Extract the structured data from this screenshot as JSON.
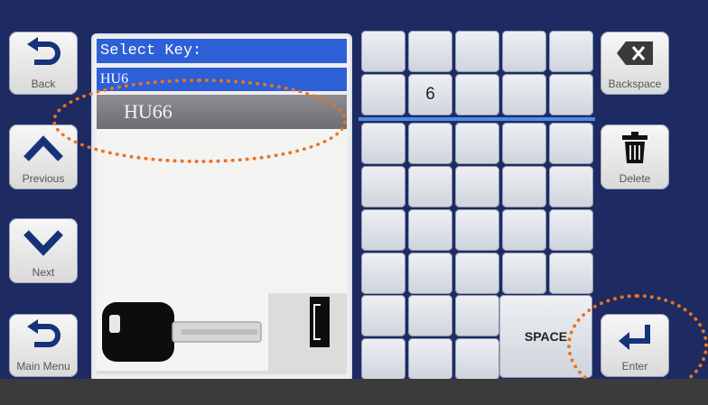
{
  "left_buttons": [
    {
      "label": "Back",
      "icon": "back-arrow-icon"
    },
    {
      "label": "Previous",
      "icon": "chevron-up-icon"
    },
    {
      "label": "Next",
      "icon": "chevron-down-icon"
    },
    {
      "label": "Main Menu",
      "icon": "back-arrow-icon"
    }
  ],
  "right_buttons": [
    {
      "label": "Backspace",
      "icon": "backspace-icon"
    },
    {
      "label": "Delete",
      "icon": "trash-icon"
    },
    {
      "label": "Enter",
      "icon": "enter-icon"
    }
  ],
  "panel": {
    "title": "Select Key:",
    "input_value": "HU6",
    "selected_result": "HU66"
  },
  "keypad": {
    "rows": [
      [
        "",
        "",
        "",
        "",
        ""
      ],
      [
        "",
        "6",
        "",
        "",
        ""
      ],
      [
        "",
        "",
        "",
        "",
        ""
      ],
      [
        "",
        "",
        "",
        "",
        ""
      ],
      [
        "",
        "",
        "",
        "",
        ""
      ],
      [
        "",
        "",
        "",
        "",
        ""
      ]
    ],
    "space_label": "SPACE"
  },
  "colors": {
    "background": "#1d2b62",
    "highlight_blue": "#2d5fd6",
    "annotation_orange": "#e8741e"
  }
}
